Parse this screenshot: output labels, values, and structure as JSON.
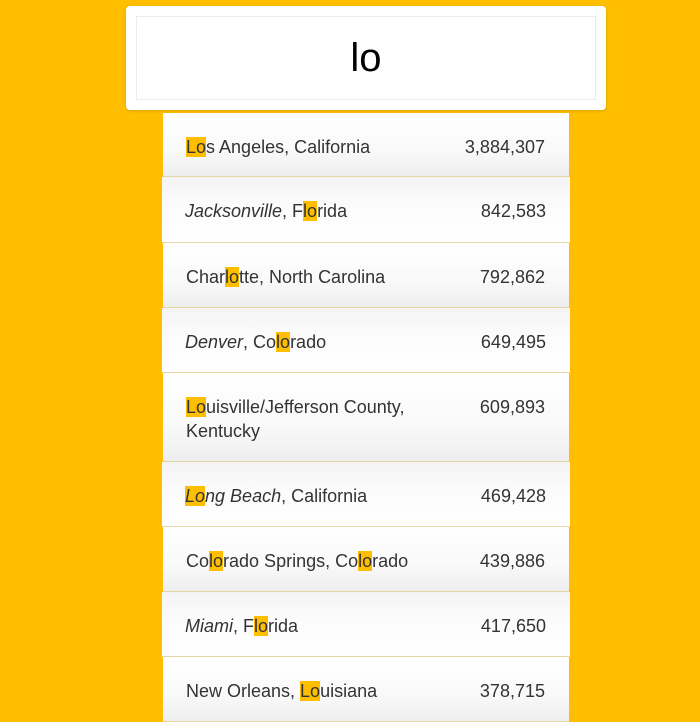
{
  "search": {
    "query": "lo"
  },
  "results": [
    {
      "segments": [
        {
          "text": "Lo",
          "hl": true
        },
        {
          "text": "s Angeles, California"
        }
      ],
      "population": "3,884,307",
      "height": 64
    },
    {
      "segments": [
        {
          "text": "Jacksonville",
          "it": true
        },
        {
          "text": ", F"
        },
        {
          "text": "lo",
          "hl": true
        },
        {
          "text": "rida"
        }
      ],
      "population": "842,583",
      "height": 66
    },
    {
      "segments": [
        {
          "text": "Char"
        },
        {
          "text": "lo",
          "hl": true
        },
        {
          "text": "tte, North Carolina"
        }
      ],
      "population": "792,862",
      "height": 65
    },
    {
      "segments": [
        {
          "text": "Denver",
          "it": true
        },
        {
          "text": ", Co"
        },
        {
          "text": "lo",
          "hl": true
        },
        {
          "text": "rado"
        }
      ],
      "population": "649,495",
      "height": 65
    },
    {
      "segments": [
        {
          "text": "Lo",
          "hl": true
        },
        {
          "text": "uisville/Jefferson County, Kentucky"
        }
      ],
      "population": "609,893",
      "height": 89
    },
    {
      "segments": [
        {
          "text": "Lo",
          "hl": true,
          "it": true
        },
        {
          "text": "ng Beach",
          "it": true
        },
        {
          "text": ", California"
        }
      ],
      "population": "469,428",
      "height": 65
    },
    {
      "segments": [
        {
          "text": "Co"
        },
        {
          "text": "lo",
          "hl": true
        },
        {
          "text": "rado Springs, Co"
        },
        {
          "text": "lo",
          "hl": true
        },
        {
          "text": "rado"
        }
      ],
      "population": "439,886",
      "height": 65
    },
    {
      "segments": [
        {
          "text": "Miami",
          "it": true
        },
        {
          "text": ", F"
        },
        {
          "text": "lo",
          "hl": true
        },
        {
          "text": "rida"
        }
      ],
      "population": "417,650",
      "height": 65
    },
    {
      "segments": [
        {
          "text": "New Orleans, "
        },
        {
          "text": "Lo",
          "hl": true
        },
        {
          "text": "uisiana"
        }
      ],
      "population": "378,715",
      "height": 65
    }
  ],
  "colors": {
    "background": "#FFBF00",
    "highlight": "#FFBF00",
    "row_border": "#e6d6a6"
  }
}
